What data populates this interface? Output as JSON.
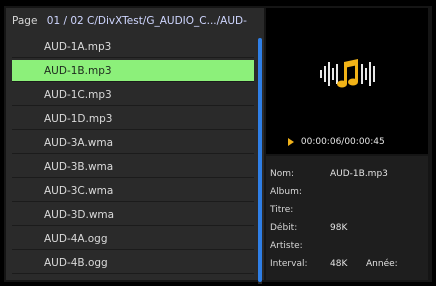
{
  "header": {
    "page_label": "Page",
    "page_value": "01 / 02 C/DivXTest/G_AUDIO_C.../AUD-"
  },
  "files": [
    {
      "name": "AUD-1A.mp3"
    },
    {
      "name": "AUD-1B.mp3"
    },
    {
      "name": "AUD-1C.mp3"
    },
    {
      "name": "AUD-1D.mp3"
    },
    {
      "name": "AUD-3A.wma"
    },
    {
      "name": "AUD-3B.wma"
    },
    {
      "name": "AUD-3C.wma"
    },
    {
      "name": "AUD-3D.wma"
    },
    {
      "name": "AUD-4A.ogg"
    },
    {
      "name": "AUD-4B.ogg"
    }
  ],
  "selected_index": 1,
  "player": {
    "time": "00:00:06/00:00:45",
    "icon": "music-note-icon"
  },
  "info": {
    "nom_label": "Nom:",
    "nom_value": "AUD-1B.mp3",
    "album_label": "Album:",
    "titre_label": "Titre:",
    "debit_label": "Débit:",
    "debit_value": "98K",
    "artiste_label": "Artiste:",
    "interval_label": "Interval:",
    "interval_value": "48K",
    "annee_label": "Année:"
  },
  "colors": {
    "selection": "#8cf07a",
    "scrollbar": "#2f7fe6",
    "accent": "#f0b21b"
  }
}
